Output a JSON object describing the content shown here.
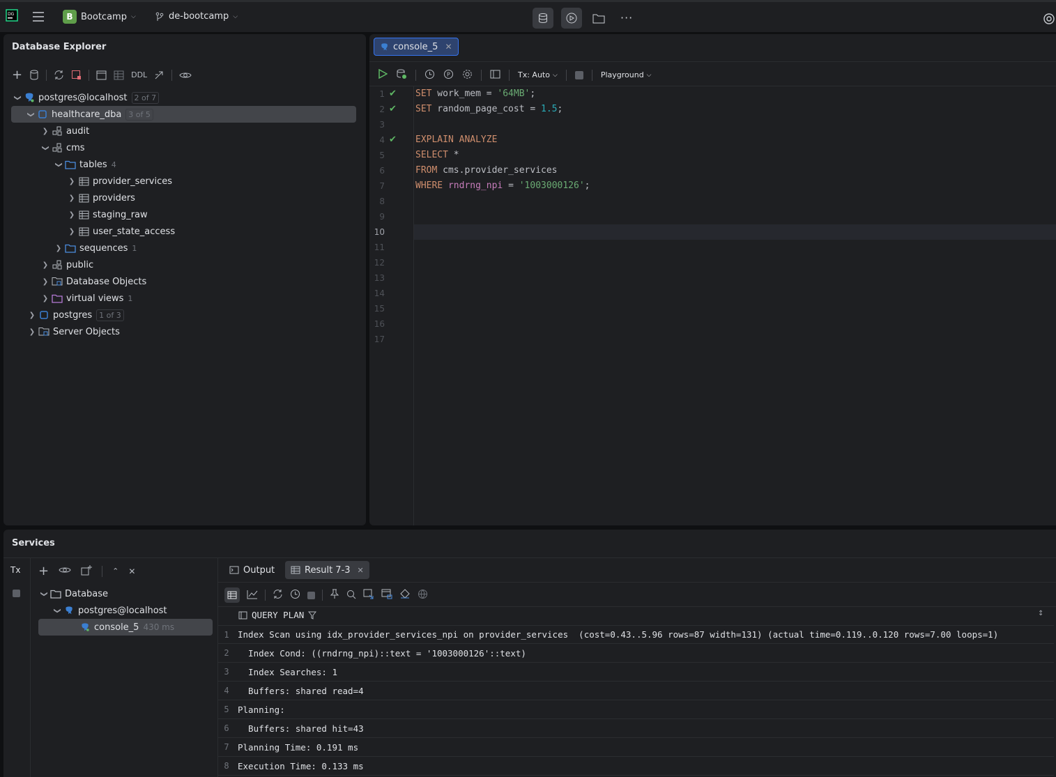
{
  "titlebar": {
    "app_icon": "datagrip-logo",
    "project_letter": "B",
    "project_name": "Bootcamp",
    "branch_name": "de-bootcamp",
    "project_color": "#5f9e4a"
  },
  "db_explorer": {
    "title": "Database Explorer",
    "toolbar_ddl": "DDL",
    "tree": [
      {
        "label": "postgres@localhost",
        "badge": "2 of 7"
      },
      {
        "label": "healthcare_dba",
        "badge": "3 of 5"
      },
      {
        "label": "audit"
      },
      {
        "label": "cms"
      },
      {
        "label": "tables",
        "count": "4"
      },
      {
        "label": "provider_services"
      },
      {
        "label": "providers"
      },
      {
        "label": "staging_raw"
      },
      {
        "label": "user_state_access"
      },
      {
        "label": "sequences",
        "count": "1"
      },
      {
        "label": "public"
      },
      {
        "label": "Database Objects"
      },
      {
        "label": "virtual views",
        "count": "1"
      },
      {
        "label": "postgres",
        "badge": "1 of 3"
      },
      {
        "label": "Server Objects"
      }
    ]
  },
  "editor": {
    "tab_label": "console_5",
    "tx_mode": "Tx: Auto",
    "playground": "Playground",
    "line_numbers": [
      "1",
      "2",
      "3",
      "4",
      "5",
      "6",
      "7",
      "8",
      "9",
      "10",
      "11",
      "12",
      "13",
      "14",
      "15",
      "16",
      "17"
    ],
    "current_line": "10"
  },
  "services": {
    "title": "Services",
    "tx_label": "Tx",
    "tree": [
      {
        "label": "Database"
      },
      {
        "label": "postgres@localhost"
      },
      {
        "label": "console_5",
        "time": "430 ms"
      }
    ],
    "tabs": {
      "output": "Output",
      "result": "Result 7-3"
    },
    "column_header": "QUERY PLAN",
    "rows": [
      {
        "n": "1",
        "v": "Index Scan using idx_provider_services_npi on provider_services  (cost=0.43..5.96 rows=87 width=131) (actual time=0.119..0.120 rows=7.00 loops=1)"
      },
      {
        "n": "2",
        "v": "  Index Cond: ((rndrng_npi)::text = '1003000126'::text)"
      },
      {
        "n": "3",
        "v": "  Index Searches: 1"
      },
      {
        "n": "4",
        "v": "  Buffers: shared read=4"
      },
      {
        "n": "5",
        "v": "Planning:"
      },
      {
        "n": "6",
        "v": "  Buffers: shared hit=43"
      },
      {
        "n": "7",
        "v": "Planning Time: 0.191 ms"
      },
      {
        "n": "8",
        "v": "Execution Time: 0.133 ms"
      }
    ]
  }
}
